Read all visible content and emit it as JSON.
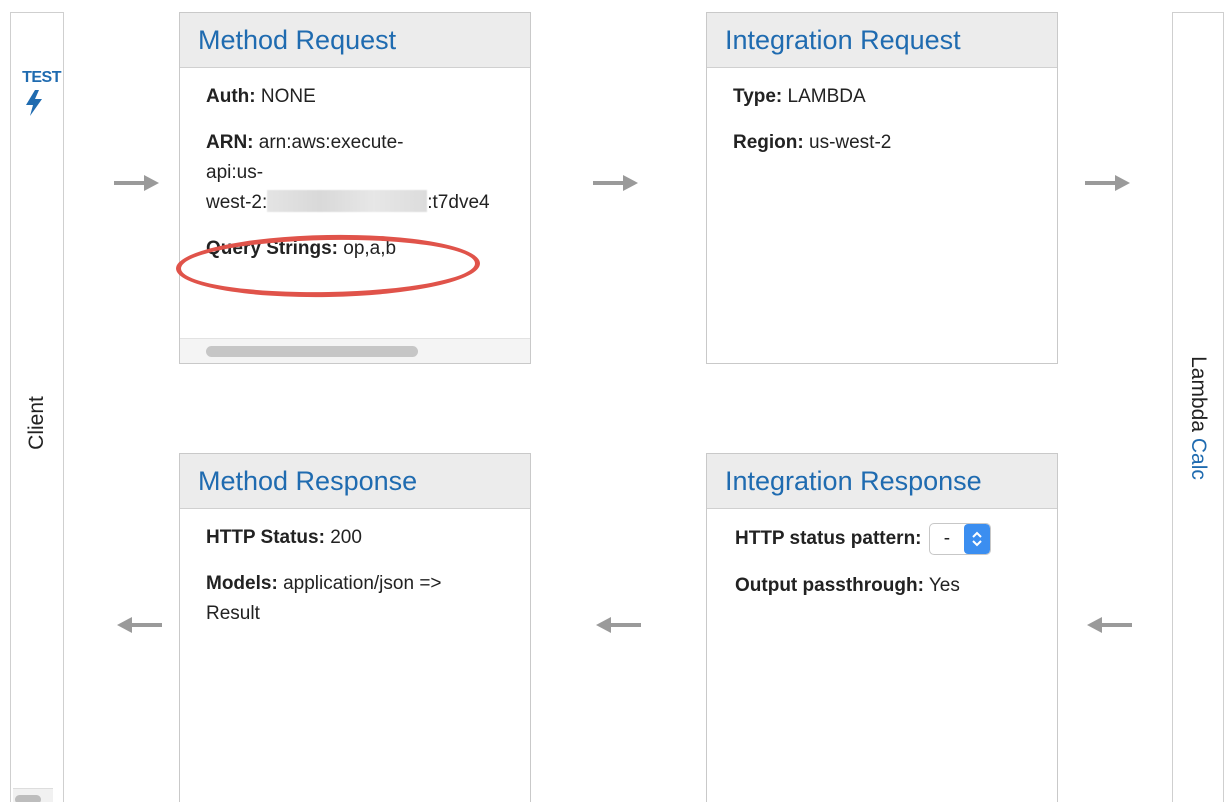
{
  "client": {
    "label": "Client",
    "test_label": "TEST",
    "test_icon": "lightning-bolt-icon"
  },
  "lambda": {
    "prefix": "Lambda",
    "link": "Calc"
  },
  "method_request": {
    "title": "Method Request",
    "auth_label": "Auth:",
    "auth_value": "NONE",
    "arn_label": "ARN:",
    "arn_line1": "arn:aws:execute-",
    "arn_line2": "api:us-",
    "arn_line3_prefix": "west-2:",
    "arn_line3_suffix": ":t7dve4",
    "query_label": "Query Strings:",
    "query_value": "op,a,b"
  },
  "integration_request": {
    "title": "Integration Request",
    "type_label": "Type:",
    "type_value": "LAMBDA",
    "region_label": "Region:",
    "region_value": "us-west-2"
  },
  "method_response": {
    "title": "Method Response",
    "status_label": "HTTP Status:",
    "status_value": "200",
    "models_label": "Models:",
    "models_value_line1": "application/json =>",
    "models_value_line2": "Result"
  },
  "integration_response": {
    "title": "Integration Response",
    "pattern_label": "HTTP status pattern:",
    "pattern_selected": "-",
    "passthrough_label": "Output passthrough:",
    "passthrough_value": "Yes"
  },
  "colors": {
    "link_blue": "#1f6bb0",
    "highlight_red": "#e0534a",
    "arrow_gray": "#9a9a9a",
    "select_blue": "#3b8ef0"
  }
}
